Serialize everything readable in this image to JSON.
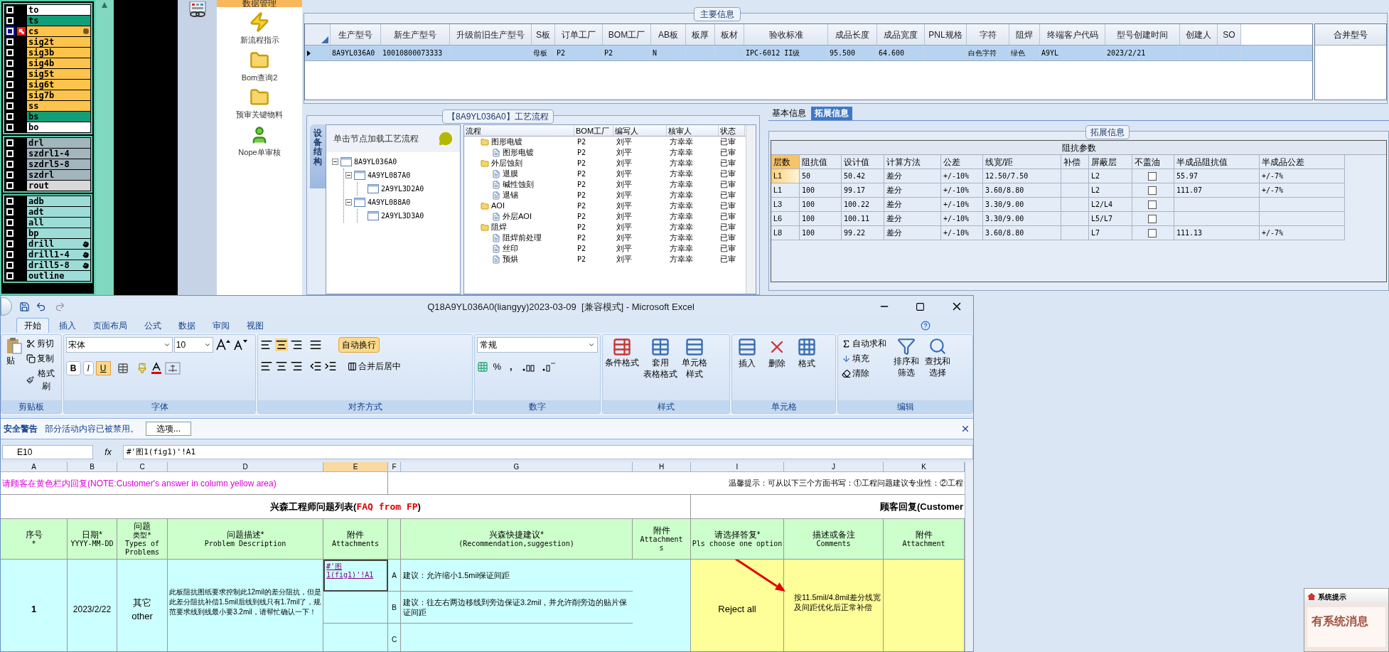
{
  "layers": {
    "groups": [
      [
        {
          "name": "to",
          "color": "#ffffff",
          "selected": false,
          "kind": "layer"
        },
        {
          "name": "ts",
          "color": "#129e78",
          "selected": false,
          "kind": "layer"
        },
        {
          "name": "cs",
          "color": "#fcc44c",
          "selected": true,
          "kind": "layer"
        },
        {
          "name": "sig2t",
          "color": "#fcc44c",
          "selected": false,
          "kind": "layer"
        },
        {
          "name": "sig3b",
          "color": "#fcc44c",
          "selected": false,
          "kind": "layer"
        },
        {
          "name": "sig4b",
          "color": "#fcc44c",
          "selected": false,
          "kind": "layer"
        },
        {
          "name": "sig5t",
          "color": "#fcc44c",
          "selected": false,
          "kind": "layer"
        },
        {
          "name": "sig6t",
          "color": "#fcc44c",
          "selected": false,
          "kind": "layer"
        },
        {
          "name": "sig7b",
          "color": "#fcc44c",
          "selected": false,
          "kind": "layer"
        },
        {
          "name": "ss",
          "color": "#fcc44c",
          "selected": false,
          "kind": "layer"
        },
        {
          "name": "bs",
          "color": "#129e78",
          "selected": false,
          "kind": "layer"
        },
        {
          "name": "bo",
          "color": "#ffffff",
          "selected": false,
          "kind": "layer"
        }
      ],
      [
        {
          "name": "drl",
          "color": "#a3b5bd",
          "selected": false,
          "kind": "layer"
        },
        {
          "name": "szdrl1-4",
          "color": "#a3b5bd",
          "selected": false,
          "kind": "layer"
        },
        {
          "name": "szdrl5-8",
          "color": "#a3b5bd",
          "selected": false,
          "kind": "layer"
        },
        {
          "name": "szdrl",
          "color": "#a3b5bd",
          "selected": false,
          "kind": "layer"
        },
        {
          "name": "rout",
          "color": "#d9d9d9",
          "selected": false,
          "kind": "layer"
        }
      ],
      [
        {
          "name": "adb",
          "color": "#9edcd8",
          "selected": false,
          "kind": "layer"
        },
        {
          "name": "adt",
          "color": "#9edcd8",
          "selected": false,
          "kind": "layer"
        },
        {
          "name": "all",
          "color": "#9edcd8",
          "selected": false,
          "kind": "layer"
        },
        {
          "name": "bp",
          "color": "#9edcd8",
          "selected": false,
          "kind": "layer"
        },
        {
          "name": "drill",
          "color": "#9edcd8",
          "selected": false,
          "kind": "drill"
        },
        {
          "name": "drill1-4",
          "color": "#9edcd8",
          "selected": false,
          "kind": "drill"
        },
        {
          "name": "drill5-8",
          "color": "#9edcd8",
          "selected": false,
          "kind": "drill"
        },
        {
          "name": "outline",
          "color": "#9edcd8",
          "selected": false,
          "kind": "layer"
        }
      ]
    ]
  },
  "nav": {
    "header": "数据管理",
    "items": [
      {
        "label": "新流程指示",
        "kind": "bolt"
      },
      {
        "label": "Bom查询2",
        "kind": "folder"
      },
      {
        "label": "预审关键物料",
        "kind": "folder"
      },
      {
        "label": "Nope单审核",
        "kind": "user"
      }
    ]
  },
  "main_info": {
    "title": "主要信息",
    "row_selected": true,
    "side_column": "合并型号",
    "columns": [
      {
        "label": "生产型号",
        "value": "8A9YL036A0"
      },
      {
        "label": "新生产型号",
        "value": "10010800073333"
      },
      {
        "label": "升级前旧生产型号"
      },
      {
        "label": "S板",
        "value": "母板"
      },
      {
        "label": "订单工厂",
        "value": "P2"
      },
      {
        "label": "BOM工厂",
        "value": "P2"
      },
      {
        "label": "AB板",
        "value": "N"
      },
      {
        "label": "板厚"
      },
      {
        "label": "板材"
      },
      {
        "label": "验收标准",
        "value": "IPC-6012 II级"
      },
      {
        "label": "成品长度",
        "value": "95.500"
      },
      {
        "label": "成品宽度",
        "value": "64.600"
      },
      {
        "label": "PNL规格"
      },
      {
        "label": "字符",
        "value": "白色字符"
      },
      {
        "label": "阻焊",
        "value": "绿色"
      },
      {
        "label": "终端客户代码",
        "value": "A9YL"
      },
      {
        "label": "型号创建时间",
        "value": "2023/2/21"
      },
      {
        "label": "创建人"
      },
      {
        "label": "SO"
      }
    ]
  },
  "process": {
    "title": "【8A9YL036A0】工艺流程",
    "side_tab": "设备结构",
    "hint": "单击节点加载工艺流程",
    "tree": [
      {
        "label": "8A9YL036A0",
        "expanded": true,
        "children": [
          {
            "label": "4A9YL087A0",
            "expanded": true,
            "children": [
              {
                "label": "2A9YL3D2A0"
              }
            ]
          },
          {
            "label": "4A9YL088A0",
            "expanded": true,
            "children": [
              {
                "label": "2A9YL3D3A0"
              }
            ]
          }
        ]
      }
    ],
    "columns": [
      "流程",
      "BOM工厂",
      "编写人",
      "核审人",
      "状态"
    ],
    "steps": [
      {
        "name": "图形电镀",
        "factory": "P2",
        "writer": "刘平",
        "reviewer": "方幸幸",
        "status": "已审",
        "children": [
          {
            "name": "图形电镀",
            "factory": "P2",
            "writer": "刘平",
            "reviewer": "方幸幸",
            "status": "已审"
          }
        ]
      },
      {
        "name": "外层蚀刻",
        "factory": "P2",
        "writer": "刘平",
        "reviewer": "方幸幸",
        "status": "已审",
        "children": [
          {
            "name": "退膜",
            "factory": "P2",
            "writer": "刘平",
            "reviewer": "方幸幸",
            "status": "已审"
          },
          {
            "name": "碱性蚀刻",
            "factory": "P2",
            "writer": "刘平",
            "reviewer": "方幸幸",
            "status": "已审"
          },
          {
            "name": "退锡",
            "factory": "P2",
            "writer": "刘平",
            "reviewer": "方幸幸",
            "status": "已审"
          }
        ]
      },
      {
        "name": "AOI",
        "factory": "P2",
        "writer": "刘平",
        "reviewer": "方幸幸",
        "status": "已审",
        "children": [
          {
            "name": "外层AOI",
            "factory": "P2",
            "writer": "刘平",
            "reviewer": "方幸幸",
            "status": "已审"
          }
        ]
      },
      {
        "name": "阻焊",
        "factory": "P2",
        "writer": "刘平",
        "reviewer": "方幸幸",
        "status": "已审",
        "children": [
          {
            "name": "阻焊前处理",
            "factory": "P2",
            "writer": "刘平",
            "reviewer": "方幸幸",
            "status": "已审"
          },
          {
            "name": "丝印",
            "factory": "P2",
            "writer": "刘平",
            "reviewer": "方幸幸",
            "status": "已审"
          },
          {
            "name": "预烘",
            "factory": "P2",
            "writer": "刘平",
            "reviewer": "方幸幸",
            "status": "已审"
          }
        ]
      }
    ]
  },
  "detail": {
    "tabs": [
      {
        "label": "基本信息",
        "selected": false
      },
      {
        "label": "拓展信息",
        "selected": true
      }
    ],
    "group_title": "拓展信息",
    "table_title": "阻抗参数",
    "columns": [
      "层数",
      "阻抗值",
      "设计值",
      "计算方法",
      "公差",
      "线宽/距",
      "补偿",
      "屏蔽层",
      "不盖油",
      "半成品阻抗值",
      "半成品公差"
    ],
    "rows": [
      {
        "selected": true,
        "layer": "L1",
        "impedance": "50",
        "design": "50.42",
        "method": "差分",
        "tolerance": "+/-10%",
        "width_space": "12.50/7.50",
        "shield": "L2",
        "no_oil": false,
        "semi_impedance": "55.97",
        "semi_tolerance": "+/-7%"
      },
      {
        "selected": false,
        "layer": "L1",
        "impedance": "100",
        "design": "99.17",
        "method": "差分",
        "tolerance": "+/-10%",
        "width_space": "3.60/8.80",
        "shield": "L2",
        "no_oil": false,
        "semi_impedance": "111.07",
        "semi_tolerance": "+/-7%"
      },
      {
        "selected": false,
        "layer": "L3",
        "impedance": "100",
        "design": "100.22",
        "method": "差分",
        "tolerance": "+/-10%",
        "width_space": "3.30/9.00",
        "shield": "L2/L4",
        "no_oil": false
      },
      {
        "selected": false,
        "layer": "L6",
        "impedance": "100",
        "design": "100.11",
        "method": "差分",
        "tolerance": "+/-10%",
        "width_space": "3.30/9.00",
        "shield": "L5/L7",
        "no_oil": false
      },
      {
        "selected": false,
        "layer": "L8",
        "impedance": "100",
        "design": "99.22",
        "method": "差分",
        "tolerance": "+/-10%",
        "width_space": "3.60/8.80",
        "shield": "L7",
        "no_oil": false,
        "semi_impedance": "111.13",
        "semi_tolerance": "+/-7%"
      }
    ]
  },
  "excel": {
    "title": "Q18A9YL036A0(liangyy)2023-03-09  [兼容模式] - Microsoft Excel",
    "tabs": [
      {
        "label": "开始",
        "selected": true
      },
      {
        "label": "插入",
        "selected": false
      },
      {
        "label": "页面布局",
        "selected": false
      },
      {
        "label": "公式",
        "selected": false
      },
      {
        "label": "数据",
        "selected": false
      },
      {
        "label": "审阅",
        "selected": false
      },
      {
        "label": "视图",
        "selected": false
      }
    ],
    "clipboard": {
      "label": "剪贴板",
      "paste": "贴",
      "cut": "剪切",
      "copy": "复制",
      "format_painter": "格式刷"
    },
    "font": {
      "label": "字体",
      "family": "宋体",
      "size": "10",
      "bold": "B",
      "italic": "I",
      "underline": "U",
      "underline_on": true
    },
    "alignment": {
      "label": "对齐方式",
      "wrap_text": "自动换行",
      "wrap_text_on": true,
      "merge": "合并后居中"
    },
    "number": {
      "label": "数字",
      "format": "常规",
      "percent": "%",
      "comma": ","
    },
    "styles": {
      "label": "样式",
      "buttons": [
        [
          "条件格式"
        ],
        [
          "套用",
          "表格格式"
        ],
        [
          "单元格",
          "样式"
        ]
      ]
    },
    "cells": {
      "label": "单元格",
      "buttons": [
        "插入",
        "删除",
        "格式"
      ]
    },
    "editing": {
      "label": "编辑",
      "autosum": "自动求和",
      "fill": "填充",
      "clear": "清除",
      "sort": [
        "排序和",
        "筛选"
      ],
      "find": [
        "查找和",
        "选择"
      ]
    },
    "security": {
      "title": "安全警告",
      "message": "部分活动内容已被禁用。",
      "button": "选项..."
    },
    "formula": {
      "name_box": "E10",
      "fx": "fx",
      "value": "#'图1(fig1)'!A1"
    },
    "columns": [
      "A",
      "B",
      "C",
      "D",
      "E",
      "F",
      "G",
      "H",
      "I",
      "J",
      "K"
    ],
    "note": "请顾客在黄色栏内回复(NOTE:Customer's answer in column yellow area)",
    "tip": "温馨提示：可从以下三个方面书写：①工程问题建议专业性：②工程",
    "left_title": {
      "text": "兴森工程师问题列表(",
      "highlight": "FAQ from FP",
      "end": ")"
    },
    "right_title": "顾客回复(Customer",
    "headers": [
      [
        "序号",
        "*"
      ],
      [
        "日期*",
        "YYYY-MM-DD"
      ],
      [
        "问题",
        "类型*",
        "Types of",
        "Problems"
      ],
      [
        "问题描述*",
        "Problem Description"
      ],
      [
        "附件",
        "Attachments"
      ],
      [
        "兴森快捷建议*",
        "(Recommendation,suggestion)"
      ],
      [
        "附件",
        "Attachment",
        "s"
      ],
      [
        "请选择答复*",
        "Pls choose one option"
      ],
      [
        "描述或备注",
        "Comments"
      ],
      [
        "附件",
        "Attachment"
      ]
    ],
    "row": {
      "number": "1",
      "date": "2023/2/22",
      "type": [
        "其它",
        "other"
      ],
      "description": "此板阻抗图纸要求控制此12mil的差分阻抗，但是此差分阻抗补偿1.5mil后线到线只有1.7mil了，规范要求线到线最小要3.2mil，请帮忙确认一下！",
      "attachment_link": "#'图1(fig1)'!A1",
      "options": [
        {
          "letter": "A",
          "text": "建议：允许缩小1.5mil保证间距"
        },
        {
          "letter": "B",
          "text": "建议：往左右两边移线到旁边保证3.2mil，并允许削旁边的贴片保证间距"
        },
        {
          "letter": "C"
        }
      ],
      "answer": "Reject all",
      "comment": "按11.5mil/4.8mil差分线宽及间距优化后正常补偿"
    }
  },
  "popup": {
    "title": "系统提示",
    "message": "有系统消息"
  }
}
